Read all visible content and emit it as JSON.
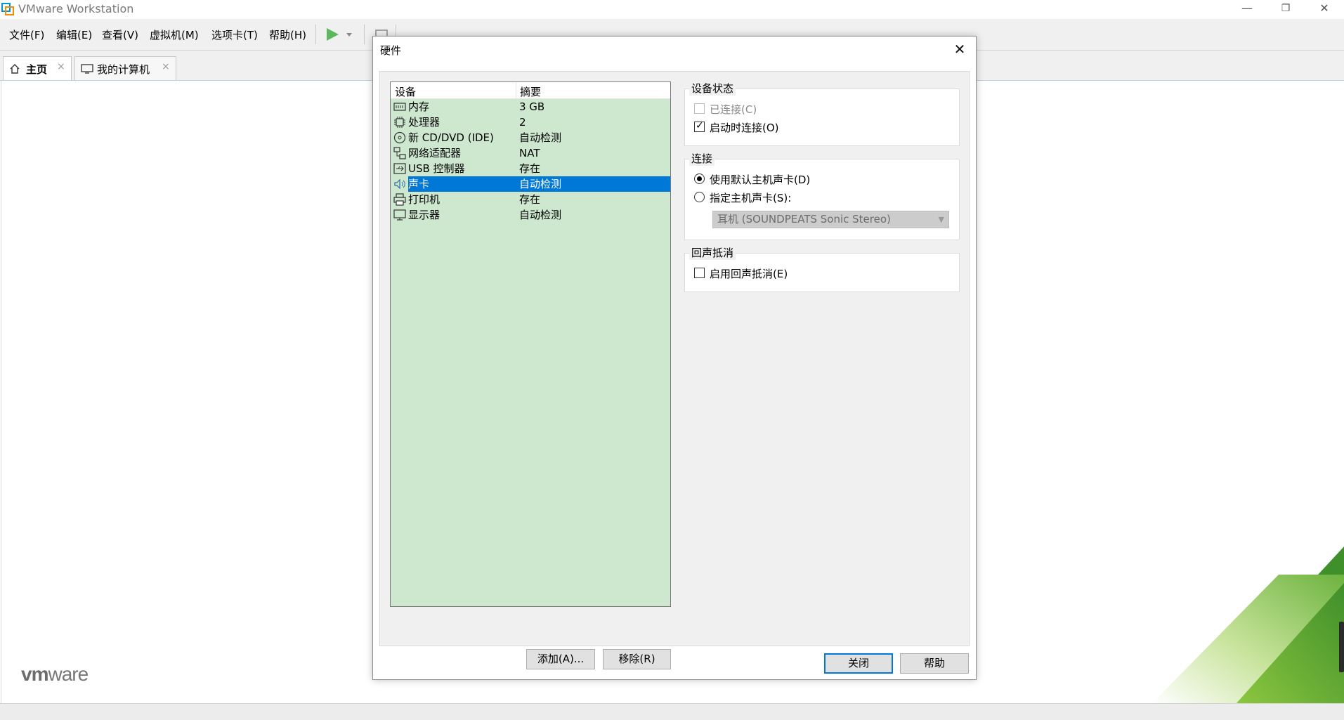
{
  "app": {
    "title": "VMware Workstation",
    "logo_text_a": "vm",
    "logo_text_b": "ware",
    "brand_green": "#6db33f",
    "brand_blue": "#0095d3"
  },
  "window_controls": {
    "minimize": "—",
    "restore": "❐",
    "close": "✕"
  },
  "menu": {
    "items": [
      "文件(F)",
      "编辑(E)",
      "查看(V)",
      "虚拟机(M)",
      "选项卡(T)",
      "帮助(H)"
    ],
    "play_icon": "play-icon",
    "dropdown_icon": "chevron-down-icon"
  },
  "tabs": [
    {
      "label": "主页",
      "icon": "home-icon",
      "active": true
    },
    {
      "label": "我的计算机",
      "icon": "monitor-icon",
      "active": false
    }
  ],
  "tab_close": "×",
  "dialog": {
    "title": "硬件",
    "close_glyph": "✕",
    "list": {
      "columns": [
        "设备",
        "摘要"
      ],
      "rows": [
        {
          "name": "内存",
          "summary": "3 GB",
          "icon": "memory-icon"
        },
        {
          "name": "处理器",
          "summary": "2",
          "icon": "cpu-icon"
        },
        {
          "name": "新 CD/DVD (IDE)",
          "summary": "自动检测",
          "icon": "cd-dvd-icon"
        },
        {
          "name": "网络适配器",
          "summary": "NAT",
          "icon": "network-adapter-icon"
        },
        {
          "name": "USB 控制器",
          "summary": "存在",
          "icon": "usb-icon"
        },
        {
          "name": "声卡",
          "summary": "自动检测",
          "icon": "speaker-icon",
          "selected": true
        },
        {
          "name": "打印机",
          "summary": "存在",
          "icon": "printer-icon"
        },
        {
          "name": "显示器",
          "summary": "自动检测",
          "icon": "display-icon"
        }
      ]
    },
    "add_button": "添加(A)...",
    "remove_button": "移除(R)",
    "device_status": {
      "title": "设备状态",
      "connected": {
        "label": "已连接(C)",
        "checked": false,
        "disabled": true
      },
      "connect_at_power_on": {
        "label": "启动时连接(O)",
        "checked": true
      }
    },
    "connection": {
      "title": "连接",
      "use_default": {
        "label": "使用默认主机声卡(D)",
        "selected": true
      },
      "specify": {
        "label": "指定主机声卡(S):",
        "selected": false
      },
      "device_select": "耳机 (SOUNDPEATS Sonic Stereo)"
    },
    "echo_cancellation": {
      "title": "回声抵消",
      "enable": {
        "label": "启用回声抵消(E)",
        "checked": false
      }
    },
    "close_button": "关闭",
    "help_button": "帮助",
    "selection_color": "#0078d7",
    "list_bg_color": "#cde8cf"
  }
}
